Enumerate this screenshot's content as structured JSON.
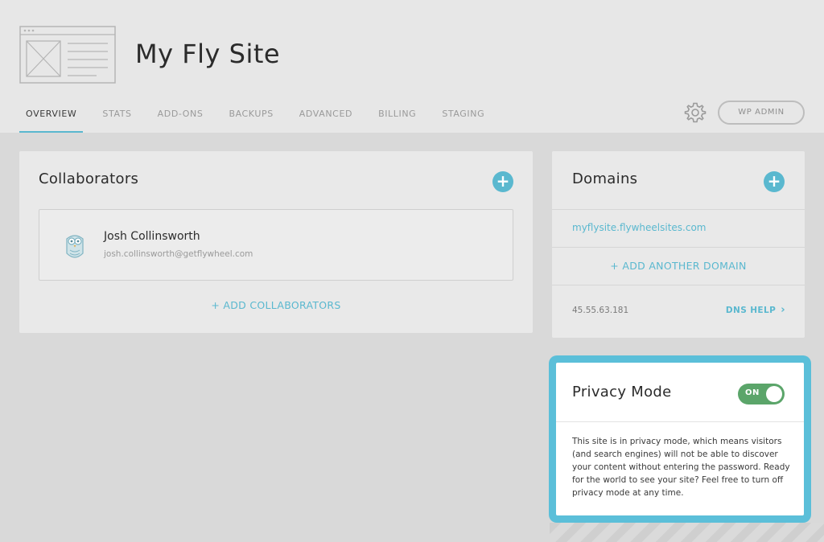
{
  "header": {
    "site_title": "My Fly Site",
    "tabs": [
      {
        "label": "OVERVIEW",
        "active": true
      },
      {
        "label": "STATS",
        "active": false
      },
      {
        "label": "ADD-ONS",
        "active": false
      },
      {
        "label": "BACKUPS",
        "active": false
      },
      {
        "label": "ADVANCED",
        "active": false
      },
      {
        "label": "BILLING",
        "active": false
      },
      {
        "label": "STAGING",
        "active": false
      }
    ],
    "wp_admin_label": "WP ADMIN"
  },
  "collaborators": {
    "title": "Collaborators",
    "add_icon": "plus-icon",
    "items": [
      {
        "name": "Josh Collinsworth",
        "email": "josh.collinsworth@getflywheel.com",
        "avatar": "owl-avatar-icon"
      }
    ],
    "add_label": "+ ADD COLLABORATORS"
  },
  "domains": {
    "title": "Domains",
    "add_icon": "plus-icon",
    "primary_domain": "myflysite.flywheelsites.com",
    "add_label": "+ ADD ANOTHER DOMAIN",
    "ip_address": "45.55.63.181",
    "dns_help_label": "DNS HELP",
    "dns_help_icon": "chevron-right-icon"
  },
  "privacy": {
    "title": "Privacy Mode",
    "toggle_label": "ON",
    "toggle_on": true,
    "description": "This site is in privacy mode, which means visitors (and search engines) will not be able to discover your content without entering the password. Ready for the world to see your site? Feel free to turn off privacy mode at any time."
  },
  "colors": {
    "accent": "#5ab8cf",
    "toggle_on": "#5ba56a",
    "highlight_border": "#5bbfd9"
  }
}
